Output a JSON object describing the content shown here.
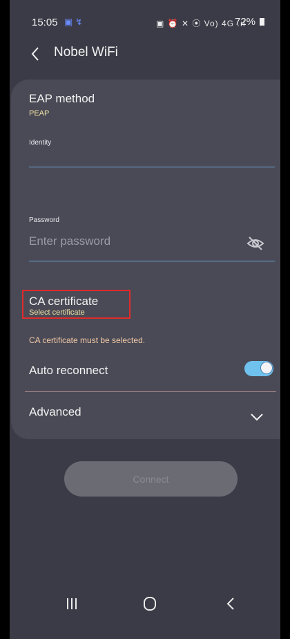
{
  "status_bar": {
    "time": "15:05",
    "notification_icons": "▣ ↯",
    "right_icons": "▣ ⏰ ✕ ⦿ Vo) 4G .ıl",
    "battery": "72%"
  },
  "header": {
    "title": "Nobel WiFi"
  },
  "eap": {
    "title": "EAP method",
    "value": "PEAP"
  },
  "identity": {
    "label": "Identity",
    "value": ""
  },
  "password": {
    "label": "Password",
    "placeholder": "Enter password"
  },
  "ca_certificate": {
    "title": "CA certificate",
    "value": "Select certificate",
    "warning": "CA certificate must be selected."
  },
  "auto_reconnect": {
    "label": "Auto reconnect",
    "enabled": true
  },
  "advanced": {
    "label": "Advanced"
  },
  "connect": {
    "label": "Connect"
  },
  "colors": {
    "background": "#3b3b47",
    "card": "#4a4a56",
    "accent": "#6fc2ee",
    "highlight_box": "#e12a2a"
  }
}
